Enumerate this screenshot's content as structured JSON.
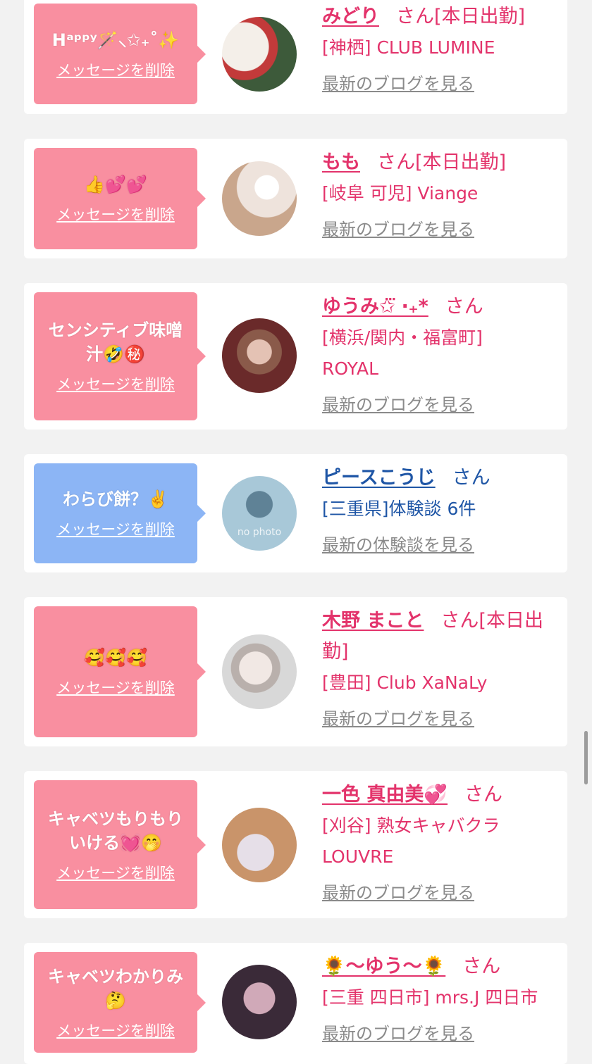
{
  "delete_label": "メッセージを削除",
  "san_label": "さん",
  "cards": [
    {
      "message": "Hᵃᵖᵖʸ🪄⸜✩₊˚✨",
      "name": "みどり",
      "status": "[本日出勤]",
      "detail": "[神栖] CLUB LUMINE",
      "link": "最新のブログを見る",
      "theme": "pink",
      "avatar": [
        "#d9d2cc",
        "#3d5a3a"
      ]
    },
    {
      "message": "👍💕💕",
      "name": "もも",
      "status": "[本日出勤]",
      "detail": "[岐阜 可児] Viange",
      "link": "最新のブログを見る",
      "theme": "pink",
      "avatar": [
        "#eee3dc",
        "#c9a68c"
      ]
    },
    {
      "message": "センシティブ味噌汁🤣㊙️",
      "name": "ゆうみ✩⃛ ‧₊*",
      "status": "",
      "detail": "[横浜/関内・福富町] ROYAL",
      "link": "最新のブログを見る",
      "theme": "pink",
      "avatar": [
        "#6a2a2a",
        "#e4c2b4"
      ]
    },
    {
      "message": "わらび餅？✌️",
      "name": "ピースこうじ",
      "status": "",
      "detail": "[三重県]体験談 6件",
      "link": "最新の体験談を見る",
      "theme": "blue",
      "avatar": [
        "#a8c8d8",
        "#5f8296"
      ],
      "avatar_text": "no photo"
    },
    {
      "message": "🥰🥰🥰",
      "name": "木野 まこと",
      "status": "[本日出勤]",
      "detail": "[豊田] Club XaNaLy",
      "link": "最新のブログを見る",
      "theme": "pink",
      "avatar": [
        "#d8d8d8",
        "#f1e8e4"
      ]
    },
    {
      "message": "キャベツもりもりいける💓🤭",
      "name": "一色 真由美💞",
      "status": "",
      "detail": "[刈谷] 熟女キャバクラ LOUVRE",
      "link": "最新のブログを見る",
      "theme": "pink",
      "avatar": [
        "#c9946a",
        "#e6dfe8"
      ]
    },
    {
      "message": "キャベツわかりみ🤔",
      "name": "🌻〜ゆう〜🌻",
      "status": "",
      "detail": "[三重 四日市] mrs.J 四日市",
      "link": "最新のブログを見る",
      "theme": "pink",
      "avatar": [
        "#3a2a38",
        "#d0a9b8"
      ]
    }
  ]
}
